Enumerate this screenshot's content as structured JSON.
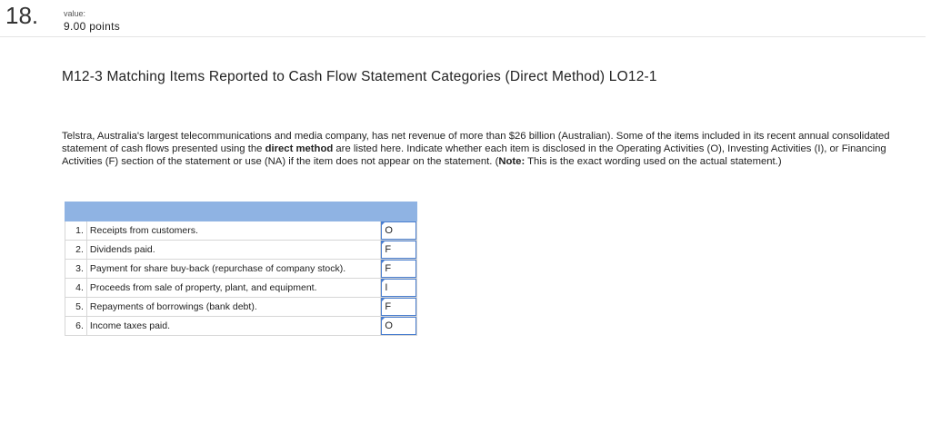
{
  "question": {
    "number": "18.",
    "value_label": "value:",
    "value_points": "9.00 points",
    "title": "M12-3 Matching Items Reported to Cash Flow Statement Categories (Direct Method) LO12-1",
    "paragraph": {
      "part1": "Telstra, Australia's largest telecommunications and media company, has net revenue of more than $26 billion (Australian). Some of the items included in its recent annual consolidated statement of cash flows presented using the ",
      "bold1": "direct method",
      "part2": " are listed here. Indicate whether each item is disclosed in the Operating Activities (O), Investing Activities (I), or Financing Activities (F) section of the statement or use (NA) if the item does not appear on the statement. (",
      "bold2": "Note:",
      "part3": " This is the exact wording used on the actual statement.)"
    }
  },
  "items": [
    {
      "num": "1.",
      "text": "Receipts from customers.",
      "answer": "O"
    },
    {
      "num": "2.",
      "text": "Dividends paid.",
      "answer": "F"
    },
    {
      "num": "3.",
      "text": "Payment for share buy-back (repurchase of company stock).",
      "answer": "F"
    },
    {
      "num": "4.",
      "text": "Proceeds from sale of property, plant, and equipment.",
      "answer": "I"
    },
    {
      "num": "5.",
      "text": "Repayments of borrowings (bank debt).",
      "answer": "F"
    },
    {
      "num": "6.",
      "text": "Income taxes paid.",
      "answer": "O"
    }
  ],
  "colors": {
    "header": "#8fb3e3",
    "input_border": "#4a7fd0"
  }
}
